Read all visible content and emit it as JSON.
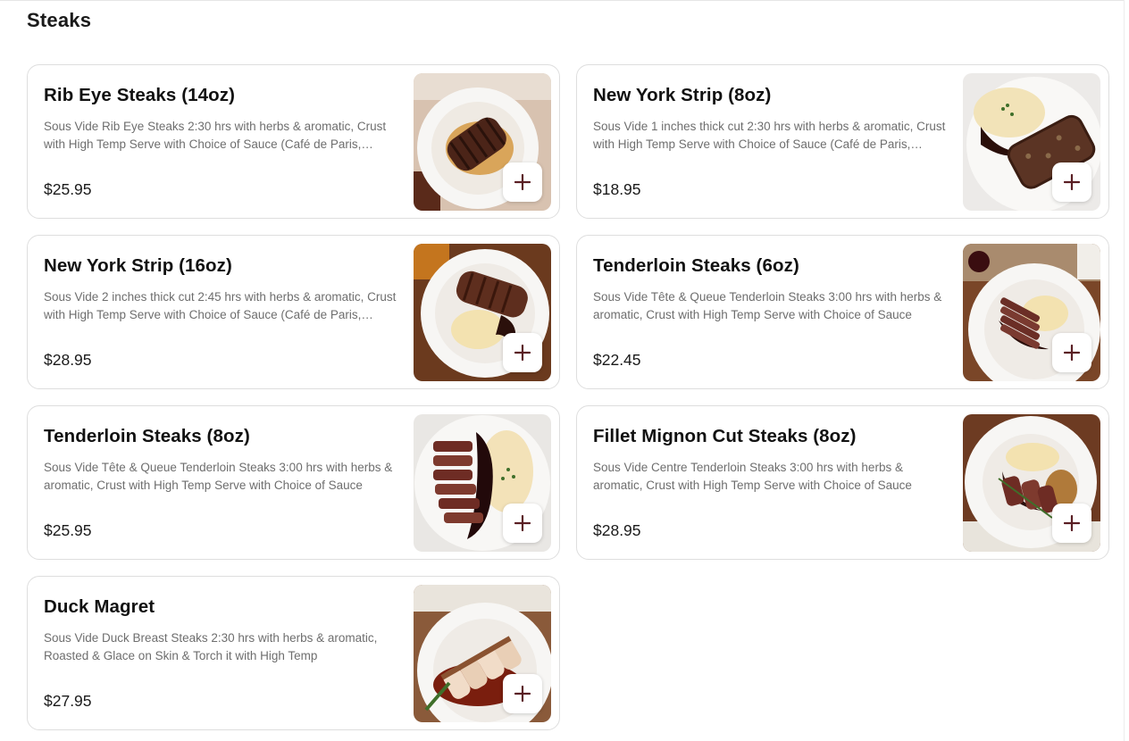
{
  "section": {
    "title": "Steaks"
  },
  "items": [
    {
      "name": "Rib Eye Steaks (14oz)",
      "description": "Sous Vide Rib Eye Steaks 2:30 hrs with herbs & aromatic, Crust with High Temp Serve with Choice of Sauce (Café de Paris, Peppercorn, Mushroom or Red Wine Jus)",
      "price": "$25.95",
      "add_label": "+"
    },
    {
      "name": "New York Strip (8oz)",
      "description": "Sous Vide 1 inches thick cut 2:30 hrs with herbs & aromatic, Crust with High Temp Serve with Choice of Sauce (Café de Paris, Peppercorn, Mushroom or Red Wine Jus)",
      "price": "$18.95",
      "add_label": "+"
    },
    {
      "name": "New York Strip (16oz)",
      "description": "Sous Vide 2 inches thick cut 2:45 hrs with herbs & aromatic, Crust with High Temp Serve with Choice of Sauce (Café de Paris, Peppercorn, Mushroom or Red Wine Jus)",
      "price": "$28.95",
      "add_label": "+"
    },
    {
      "name": "Tenderloin Steaks (6oz)",
      "description": "Sous Vide Tête & Queue Tenderloin Steaks 3:00 hrs with herbs & aromatic, Crust with High Temp Serve with Choice of Sauce",
      "price": "$22.45",
      "add_label": "+"
    },
    {
      "name": "Tenderloin Steaks (8oz)",
      "description": "Sous Vide Tête & Queue Tenderloin Steaks 3:00 hrs with herbs & aromatic, Crust with High Temp Serve with Choice of Sauce",
      "price": "$25.95",
      "add_label": "+"
    },
    {
      "name": "Fillet Mignon Cut Steaks (8oz)",
      "description": "Sous Vide Centre Tenderloin Steaks 3:00 hrs with herbs & aromatic, Crust with High Temp Serve with Choice of Sauce",
      "price": "$28.95",
      "add_label": "+"
    },
    {
      "name": "Duck Magret",
      "description": "Sous Vide Duck Breast Steaks 2:30 hrs with herbs & aromatic, Roasted & Glace on Skin & Torch it with High Temp",
      "price": "$27.95",
      "add_label": "+"
    }
  ],
  "colors": {
    "add_icon": "#5a1f24",
    "border": "#dedede",
    "description": "#6e6e6e"
  },
  "icons": {
    "add": "plus-icon"
  }
}
